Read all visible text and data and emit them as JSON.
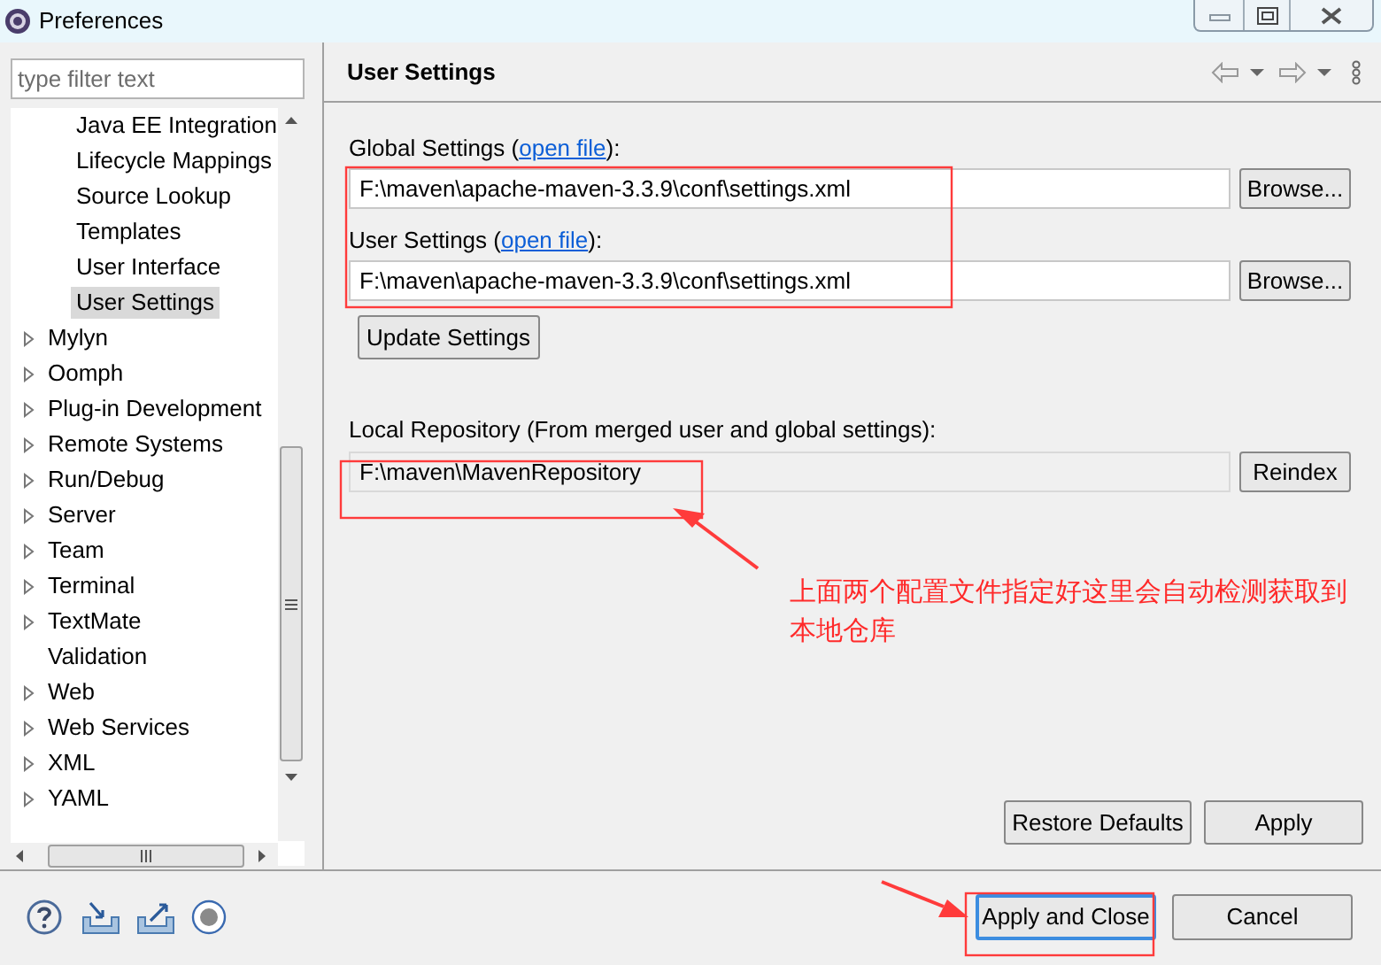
{
  "window": {
    "title": "Preferences"
  },
  "filter": {
    "placeholder": "type filter text"
  },
  "tree": [
    {
      "label": "Java EE Integration",
      "kind": "child",
      "selected": false
    },
    {
      "label": "Lifecycle Mappings",
      "kind": "child",
      "selected": false
    },
    {
      "label": "Source Lookup",
      "kind": "child",
      "selected": false
    },
    {
      "label": "Templates",
      "kind": "child",
      "selected": false
    },
    {
      "label": "User Interface",
      "kind": "child",
      "selected": false
    },
    {
      "label": "User Settings",
      "kind": "child",
      "selected": true
    },
    {
      "label": "Mylyn",
      "kind": "node",
      "expanded": false,
      "selected": false
    },
    {
      "label": "Oomph",
      "kind": "node",
      "expanded": false,
      "selected": false
    },
    {
      "label": "Plug-in Development",
      "kind": "node",
      "expanded": false,
      "selected": false
    },
    {
      "label": "Remote Systems",
      "kind": "node",
      "expanded": false,
      "selected": false
    },
    {
      "label": "Run/Debug",
      "kind": "node",
      "expanded": false,
      "selected": false
    },
    {
      "label": "Server",
      "kind": "node",
      "expanded": false,
      "selected": false
    },
    {
      "label": "Team",
      "kind": "node",
      "expanded": false,
      "selected": false
    },
    {
      "label": "Terminal",
      "kind": "node",
      "expanded": false,
      "selected": false
    },
    {
      "label": "TextMate",
      "kind": "node",
      "expanded": false,
      "selected": false
    },
    {
      "label": "Validation",
      "kind": "leaf",
      "selected": false
    },
    {
      "label": "Web",
      "kind": "node",
      "expanded": false,
      "selected": false
    },
    {
      "label": "Web Services",
      "kind": "node",
      "expanded": false,
      "selected": false
    },
    {
      "label": "XML",
      "kind": "node",
      "expanded": false,
      "selected": false
    },
    {
      "label": "YAML",
      "kind": "node",
      "expanded": false,
      "selected": false
    }
  ],
  "page": {
    "title": "User Settings",
    "global": {
      "label_before": "Global Settings (",
      "link": "open file",
      "label_after": "):",
      "value": "F:\\maven\\apache-maven-3.3.9\\conf\\settings.xml",
      "button": "Browse..."
    },
    "user": {
      "label_before": "User Settings (",
      "link": "open file",
      "label_after": "):",
      "value": "F:\\maven\\apache-maven-3.3.9\\conf\\settings.xml",
      "button": "Browse..."
    },
    "update_button": "Update Settings",
    "local": {
      "label": "Local Repository (From merged user and global settings):",
      "value": "F:\\maven\\MavenRepository",
      "disabled": true,
      "button": "Reindex"
    },
    "restore_button": "Restore Defaults",
    "apply_button": "Apply"
  },
  "buttons": [
    {
      "label": "Apply and Close",
      "default": true
    },
    {
      "label": "Cancel",
      "default": false
    }
  ],
  "annotation": {
    "text": "上面两个配置文件指定好这里会自动检测获取到本地仓库"
  }
}
